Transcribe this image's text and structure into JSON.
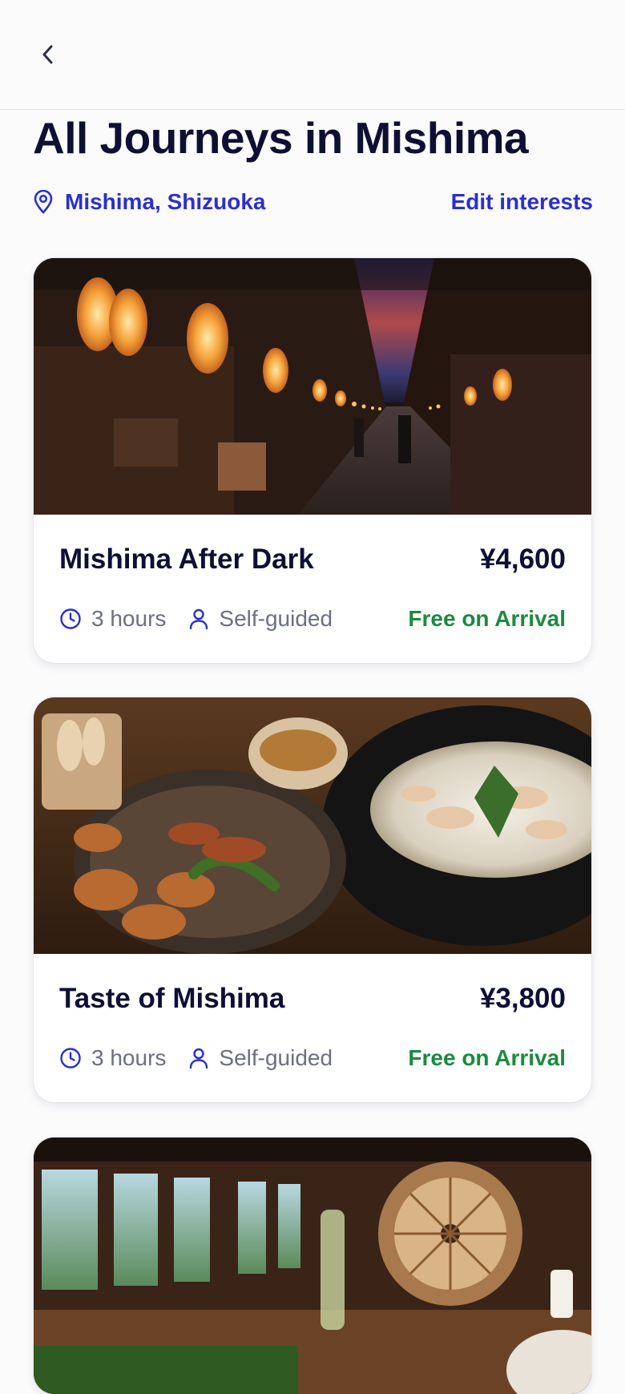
{
  "header": {
    "back_icon": "chevron-left-icon"
  },
  "page": {
    "title": "All Journeys in Mishima",
    "location": "Mishima, Shizuoka",
    "location_icon": "map-pin-icon",
    "edit_interests": "Edit interests"
  },
  "colors": {
    "accent": "#2a2fd0",
    "title": "#0d1033",
    "success": "#1b8a3e",
    "muted": "#6b6f80"
  },
  "journeys": [
    {
      "title": "Mishima After Dark",
      "price": "¥4,600",
      "duration": "3 hours",
      "guide": "Self-guided",
      "status": "Free on Arrival",
      "image": "night street with lanterns"
    },
    {
      "title": "Taste of Mishima",
      "price": "¥3,800",
      "duration": "3 hours",
      "guide": "Self-guided",
      "status": "Free on Arrival",
      "image": "plates of food and soup bowl"
    },
    {
      "image": "restaurant interior with table setting"
    }
  ]
}
